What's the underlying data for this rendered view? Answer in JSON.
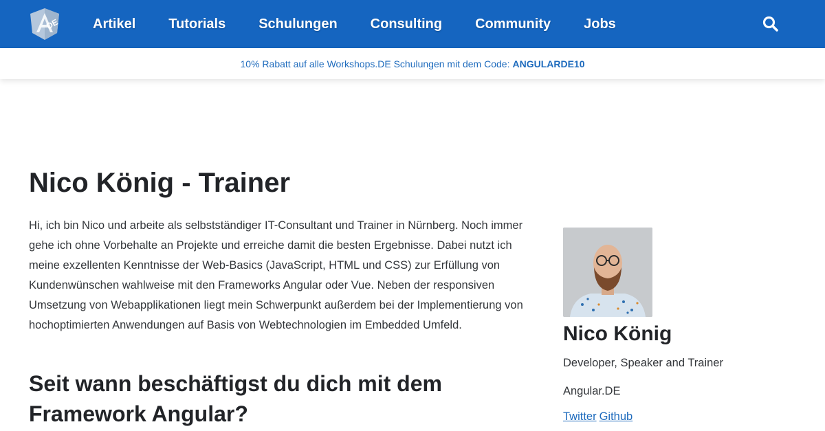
{
  "header": {
    "logo_text": "DE",
    "nav": [
      {
        "label": "Artikel"
      },
      {
        "label": "Tutorials"
      },
      {
        "label": "Schulungen"
      },
      {
        "label": "Consulting"
      },
      {
        "label": "Community"
      },
      {
        "label": "Jobs"
      }
    ],
    "search_icon": "search-icon",
    "bg_color": "#1565c0"
  },
  "promo": {
    "text": "10% Rabatt auf alle Workshops.DE Schulungen mit dem Code:",
    "code": "ANGULARDE10",
    "color": "#1e6bbd"
  },
  "main": {
    "title": "Nico König - Trainer",
    "intro": "Hi, ich bin Nico und arbeite als selbstständiger IT-Consultant und Trainer in Nürnberg. Noch immer gehe ich ohne Vorbehalte an Projekte und erreiche damit die besten Ergebnisse. Dabei nutzt ich meine exzellenten Kenntnisse der Web-Basics (JavaScript, HTML und CSS) zur Erfüllung von Kundenwünschen wahlweise mit den Frameworks Angular oder Vue. Neben der responsiven Umsetzung von Webapplikationen liegt mein Schwerpunkt außerdem bei der Implementierung von hochoptimierten Anwendungen auf Basis von Webtechnologien im Embedded Umfeld.",
    "section_title": "Seit wann beschäftigst du dich mit dem Framework Angular?"
  },
  "sidebar": {
    "name": "Nico König",
    "role": "Developer, Speaker and Trainer",
    "company": "Angular.DE",
    "links": [
      {
        "label": "Twitter"
      },
      {
        "label": "Github"
      }
    ],
    "link_color": "#1e6bbd"
  }
}
